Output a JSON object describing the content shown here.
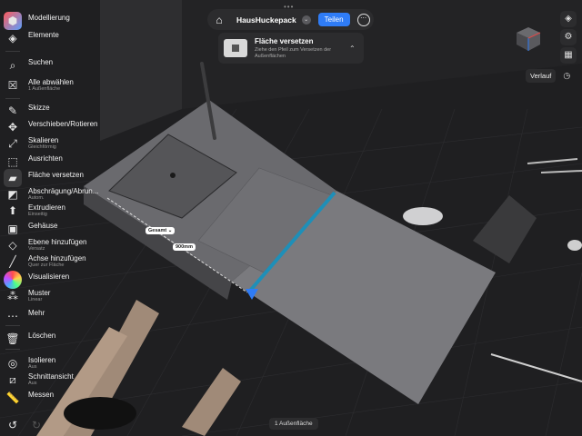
{
  "sidebar": {
    "items": [
      {
        "label": "Modellierung",
        "sub": "",
        "icon": "modeling-icon"
      },
      {
        "label": "Elemente",
        "sub": "",
        "icon": "elements-icon"
      },
      {
        "label": "Suchen",
        "sub": "",
        "icon": "search-icon"
      },
      {
        "label": "Alle abwählen",
        "sub": "1 Außenfläche",
        "icon": "deselect-icon"
      },
      {
        "label": "Skizze",
        "sub": "",
        "icon": "sketch-icon"
      },
      {
        "label": "Verschieben/Rotieren",
        "sub": "",
        "icon": "move-rotate-icon"
      },
      {
        "label": "Skalieren",
        "sub": "Gleichförmig",
        "icon": "scale-icon"
      },
      {
        "label": "Ausrichten",
        "sub": "",
        "icon": "align-icon"
      },
      {
        "label": "Fläche versetzen",
        "sub": "",
        "icon": "offset-face-icon"
      },
      {
        "label": "Abschrägung/Abrun...",
        "sub": "Autom.",
        "icon": "bevel-icon"
      },
      {
        "label": "Extrudieren",
        "sub": "Einseitig",
        "icon": "extrude-icon"
      },
      {
        "label": "Gehäuse",
        "sub": "",
        "icon": "shell-icon"
      },
      {
        "label": "Ebene hinzufügen",
        "sub": "Versatz",
        "icon": "add-plane-icon"
      },
      {
        "label": "Achse hinzufügen",
        "sub": "Quer zur Fläche",
        "icon": "add-axis-icon"
      },
      {
        "label": "Visualisieren",
        "sub": "",
        "icon": "visualize-icon"
      },
      {
        "label": "Muster",
        "sub": "Linear",
        "icon": "pattern-icon"
      },
      {
        "label": "Mehr",
        "sub": "",
        "icon": "more-icon"
      },
      {
        "label": "Löschen",
        "sub": "",
        "icon": "trash-icon"
      },
      {
        "label": "Isolieren",
        "sub": "Aus",
        "icon": "isolate-icon"
      },
      {
        "label": "Schnittansicht",
        "sub": "Aus",
        "icon": "section-view-icon"
      },
      {
        "label": "Messen",
        "sub": "",
        "icon": "measure-icon"
      }
    ]
  },
  "topbar": {
    "doc_name": "HausHuckepack",
    "share_label": "Teilen"
  },
  "card": {
    "title": "Fläche versetzen",
    "description": "Ziehe den Pfeil zum Versetzen der Außenflächen"
  },
  "right": {
    "history_label": "Verlauf"
  },
  "viewport": {
    "measure_mode": "Gesamt",
    "measure_value": "900mm"
  },
  "status": {
    "selection": "1 Außenfläche"
  },
  "colors": {
    "accent": "#2f7cf6",
    "selected_edge": "#1e8fb8",
    "panel": "#2c2c2e"
  }
}
